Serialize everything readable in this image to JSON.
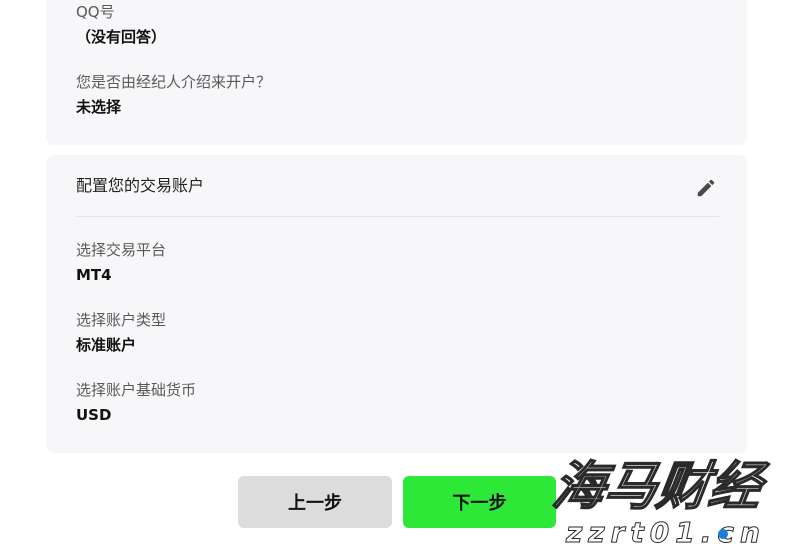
{
  "personal_section": {
    "fields": [
      {
        "label": "QQ号",
        "value": "（没有回答）"
      },
      {
        "label": "您是否由经纪人介绍来开户？",
        "value": "未选择"
      }
    ]
  },
  "trading_section": {
    "title": "配置您的交易账户",
    "edit_icon": "pencil-icon",
    "fields": [
      {
        "label": "选择交易平台",
        "value": "MT4"
      },
      {
        "label": "选择账户类型",
        "value": "标准账户"
      },
      {
        "label": "选择账户基础货币",
        "value": "USD"
      }
    ]
  },
  "buttons": {
    "prev_label": "上一步",
    "next_label": "下一步"
  },
  "watermark": {
    "brand": "海马财经",
    "site": "zzrt01.cn"
  },
  "colors": {
    "card_bg": "#f7f7f9",
    "next_button": "#2ee838",
    "prev_button": "#dcdcdc",
    "watermark_text": "#ffffff",
    "watermark_dot": "#1a7fd9"
  }
}
